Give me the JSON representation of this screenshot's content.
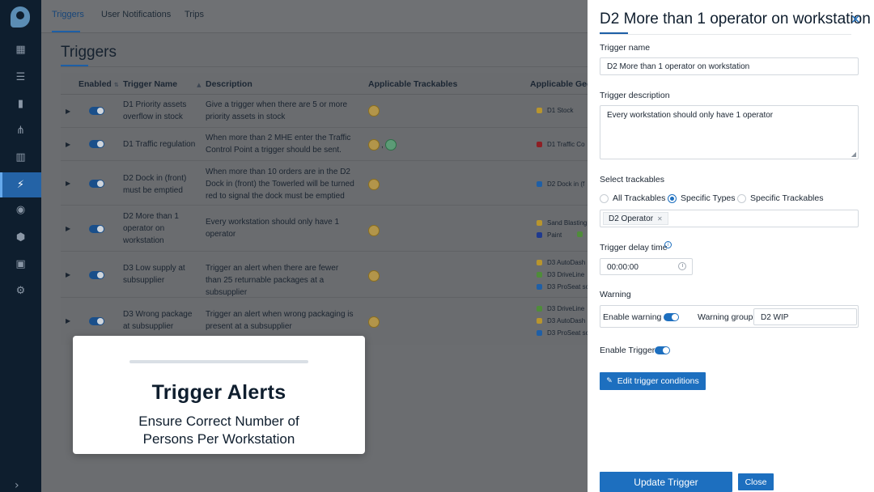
{
  "nav": {
    "tabs": [
      {
        "label": "Triggers"
      },
      {
        "label": "User Notifications"
      },
      {
        "label": "Trips"
      }
    ]
  },
  "sidebar": {
    "items": [
      {
        "icon": "map-icon"
      },
      {
        "icon": "list-icon"
      },
      {
        "icon": "person-badge-icon"
      },
      {
        "icon": "flow-icon"
      },
      {
        "icon": "chart-icon"
      },
      {
        "icon": "lightning-icon",
        "active": true
      },
      {
        "icon": "broadcast-icon"
      },
      {
        "icon": "package-icon"
      },
      {
        "icon": "calendar-icon"
      },
      {
        "icon": "settings-group-icon"
      }
    ],
    "bottom_icon": "chevron-right-icon"
  },
  "page": {
    "title": "Triggers"
  },
  "table": {
    "headers": {
      "enabled": "Enabled",
      "name": "Trigger Name",
      "description": "Description",
      "trackables": "Applicable Trackables",
      "geofences": "Applicable Geof"
    },
    "rows": [
      {
        "name": "D1 Priority assets overflow in stock",
        "description": "Give a trigger when there are 5 or more priority assets in stock",
        "geofences": [
          {
            "label": "D1 Stock",
            "color": "#b8952d"
          }
        ]
      },
      {
        "name": "D1 Traffic regulation",
        "description": "When more than 2 MHE enter the Traffic Control Point a trigger should be sent.",
        "geofences": [
          {
            "label": "D1 Traffic Co",
            "color": "#8e1f24"
          }
        ]
      },
      {
        "name": "D2 Dock in (front) must be emptied",
        "description": "When more than 10 orders are in the D2 Dock in (front) the Towerled will be turned red to signal the dock must be emptied",
        "geofences": [
          {
            "label": "D2 Dock in (f",
            "color": "#1f5fa6"
          }
        ]
      },
      {
        "name": "D2 More than 1 operator on workstation",
        "description": "Every workstation should only have 1 operator",
        "geofences": [
          {
            "label": "Sand Blasting",
            "color": "#b8952d"
          },
          {
            "label": "Paint",
            "color": "#1f3a8f"
          }
        ]
      },
      {
        "name": "D3 Low supply at subsupplier",
        "description": "Trigger an alert when there are fewer than 25 returnable packages at a subsupplier",
        "geofences": [
          {
            "label": "D3 AutoDash",
            "color": "#b8952d"
          },
          {
            "label": "D3 DriveLine",
            "color": "#4f8c3a"
          },
          {
            "label": "D3 ProSeat sc",
            "color": "#1f5fa6"
          }
        ]
      },
      {
        "name": "D3 Wrong package at subsupplier",
        "description": "Trigger an alert when wrong packaging is present at a subsupplier",
        "geofences": [
          {
            "label": "D3 DriveLine",
            "color": "#4f8c3a"
          },
          {
            "label": "D3 AutoDash",
            "color": "#b8952d"
          },
          {
            "label": "D3 ProSeat sc",
            "color": "#1f5fa6"
          }
        ]
      }
    ]
  },
  "card": {
    "title": "Trigger Alerts",
    "subtitle_line1": "Ensure Correct Number of",
    "subtitle_line2": "Persons Per Workstation"
  },
  "panel": {
    "title": "D2 More than 1 operator on workstation",
    "name_label": "Trigger name",
    "name_value": "D2 More than 1 operator on workstation",
    "description_label": "Trigger description",
    "description_value": "Every workstation should only have 1 operator",
    "trackables_label": "Select trackables",
    "radio_options": [
      "All Trackables",
      "Specific Types",
      "Specific Trackables"
    ],
    "selected_radio": "Specific Types",
    "selected_tag": "D2 Operator",
    "delay_label": "Trigger delay time",
    "delay_value": "00:00:00",
    "warning_label": "Warning",
    "enable_warning_label": "Enable warning",
    "warning_group_label": "Warning group",
    "warning_group_value": "D2 WIP",
    "enable_trigger_label": "Enable Trigger",
    "edit_conditions_label": "Edit trigger conditions",
    "update_label": "Update Trigger",
    "close_label": "Close"
  }
}
